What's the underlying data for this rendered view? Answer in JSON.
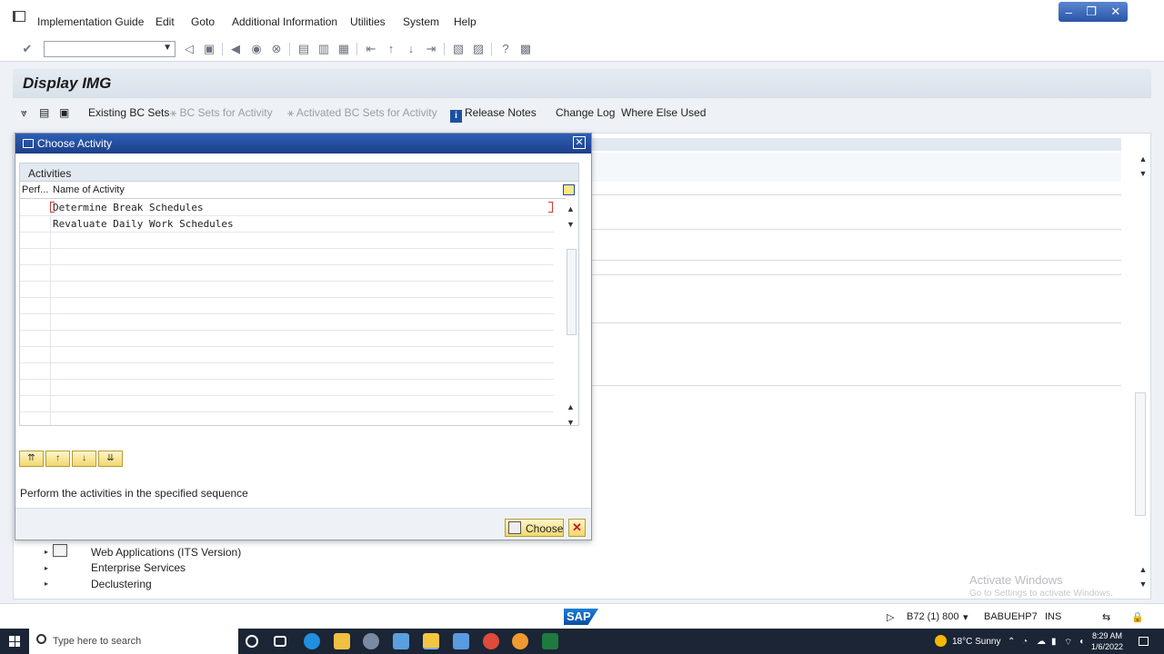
{
  "menu": [
    "Implementation Guide",
    "Edit",
    "Goto",
    "Additional Information",
    "Utilities",
    "System",
    "Help"
  ],
  "window_controls": {
    "minimize": "–",
    "restore": "❐",
    "close": "✕"
  },
  "page_title": "Display IMG",
  "app_toolbar": {
    "existing_bc_sets": "Existing BC Sets",
    "bc_sets_for_activity": "BC Sets for Activity",
    "activated_bc_sets": "Activated BC Sets for Activity",
    "release_notes": "Release Notes",
    "change_log": "Change Log",
    "where_else_used": "Where Else Used"
  },
  "tree": [
    {
      "label": "Web Applications (ITS Version)"
    },
    {
      "label": "Enterprise Services"
    },
    {
      "label": "Declustering"
    }
  ],
  "dialog": {
    "title": "Choose Activity",
    "table_caption": "Activities",
    "columns": {
      "perf": "Perf...",
      "name": "Name of Activity"
    },
    "rows": [
      {
        "name": "Determine Break Schedules"
      },
      {
        "name": "Revaluate Daily Work Schedules"
      }
    ],
    "hint": "Perform the activities in the specified sequence",
    "choose_label": "Choose",
    "cancel_label": "✕"
  },
  "watermark": {
    "line1": "Activate Windows",
    "line2": "Go to Settings to activate Windows."
  },
  "statusbar": {
    "logo": "SAP",
    "system": "B72 (1) 800",
    "server": "BABUEHP7",
    "mode": "INS"
  },
  "taskbar": {
    "search_placeholder": "Type here to search",
    "weather": "18°C  Sunny",
    "time": "8:29 AM",
    "date": "1/6/2022"
  },
  "colors": {
    "dialog_header": "#2d5fb5",
    "sap_blue": "#1c7ed6",
    "cancel_red": "#d01818"
  }
}
